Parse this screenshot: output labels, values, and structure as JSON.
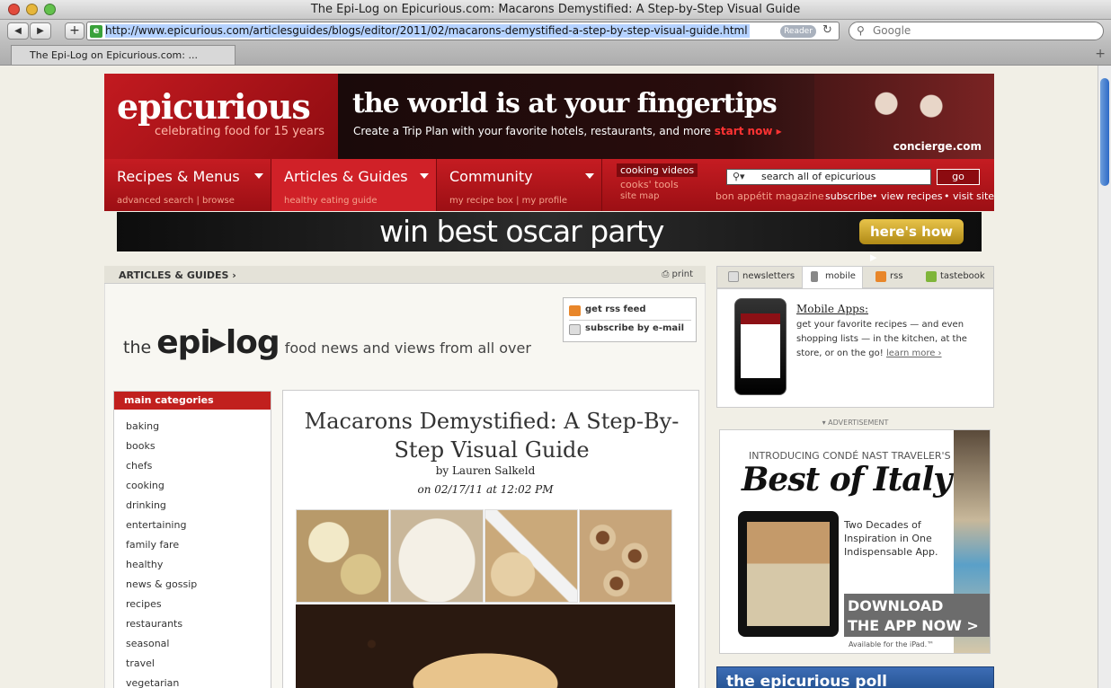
{
  "window": {
    "title": "The Epi-Log on Epicurious.com: Macarons Demystified: A Step-by-Step Visual Guide"
  },
  "toolbar": {
    "url": "http://www.epicurious.com/articlesguides/blogs/editor/2011/02/macarons-demystified-a-step-by-step-visual-guide.html",
    "reader_label": "Reader",
    "search_placeholder": "Google"
  },
  "tabs": [
    {
      "label": "The Epi-Log on Epicurious.com: ..."
    }
  ],
  "header": {
    "logo": "epicurious",
    "tagline": "celebrating food for 15 years",
    "banner_headline": "the world is at your fingertips",
    "banner_sub": "Create a Trip Plan with your favorite hotels, restaurants, and more",
    "banner_cta": "start now ▸",
    "banner_brand": "concierge.com"
  },
  "nav": {
    "recipes": {
      "label": "Recipes & Menus",
      "sub1": "advanced search",
      "sub2": "browse"
    },
    "articles": {
      "label": "Articles & Guides",
      "sub1": "healthy eating guide"
    },
    "community": {
      "label": "Community",
      "sub1": "my recipe box",
      "sub2": "my profile"
    },
    "cooking_videos": "cooking videos",
    "cooks_tools": "cooks' tools",
    "site_map": "site map",
    "search_placeholder": "search all of epicurious",
    "go_label": "go",
    "bon_appetit": "bon appétit magazine",
    "subscribe": "subscribe",
    "view_recipes": "view recipes",
    "visit_site": "visit site"
  },
  "oscar_banner": {
    "text": "win best oscar party",
    "button": "here's how ▸"
  },
  "breadcrumb": {
    "label": "ARTICLES & GUIDES ›",
    "print": "print"
  },
  "epilog": {
    "prefix": "the",
    "name": "epi▸log",
    "tagline": "food news and views from all over"
  },
  "feed": {
    "rss": "get rss feed",
    "email": "subscribe by e-mail"
  },
  "categories": {
    "heading": "main categories",
    "items": [
      "baking",
      "books",
      "chefs",
      "cooking",
      "drinking",
      "entertaining",
      "family fare",
      "healthy",
      "news & gossip",
      "recipes",
      "restaurants",
      "seasonal",
      "travel",
      "vegetarian"
    ]
  },
  "article": {
    "title": "Macarons Demystified: A Step-By-Step Visual Guide",
    "byline": "by Lauren Salkeld",
    "date": "on 02/17/11 at 12:02 PM"
  },
  "right_tabs": {
    "newsletters": "newsletters",
    "mobile": "mobile",
    "rss": "rss",
    "tastebook": "tastebook"
  },
  "mobile": {
    "title": "Mobile Apps:",
    "desc": "get your favorite recipes — and even shopping lists — in the kitchen, at the store, or on the go!",
    "learn_more": "learn more ›"
  },
  "ad": {
    "label": "▾ ADVERTISEMENT",
    "intro": "INTRODUCING CONDÉ NAST TRAVELER'S",
    "headline": "Best of Italy",
    "sub": "Two Decades of Inspiration in One Indispensable App.",
    "cta1": "DOWNLOAD",
    "cta2": "THE APP NOW >",
    "avail": "Available for the iPad.™"
  },
  "poll": {
    "label": "the epicurious poll"
  },
  "colors": {
    "brand_red": "#b5141b",
    "nav_sub": "#f4a28c",
    "cta_gold": "#c9a22c"
  }
}
